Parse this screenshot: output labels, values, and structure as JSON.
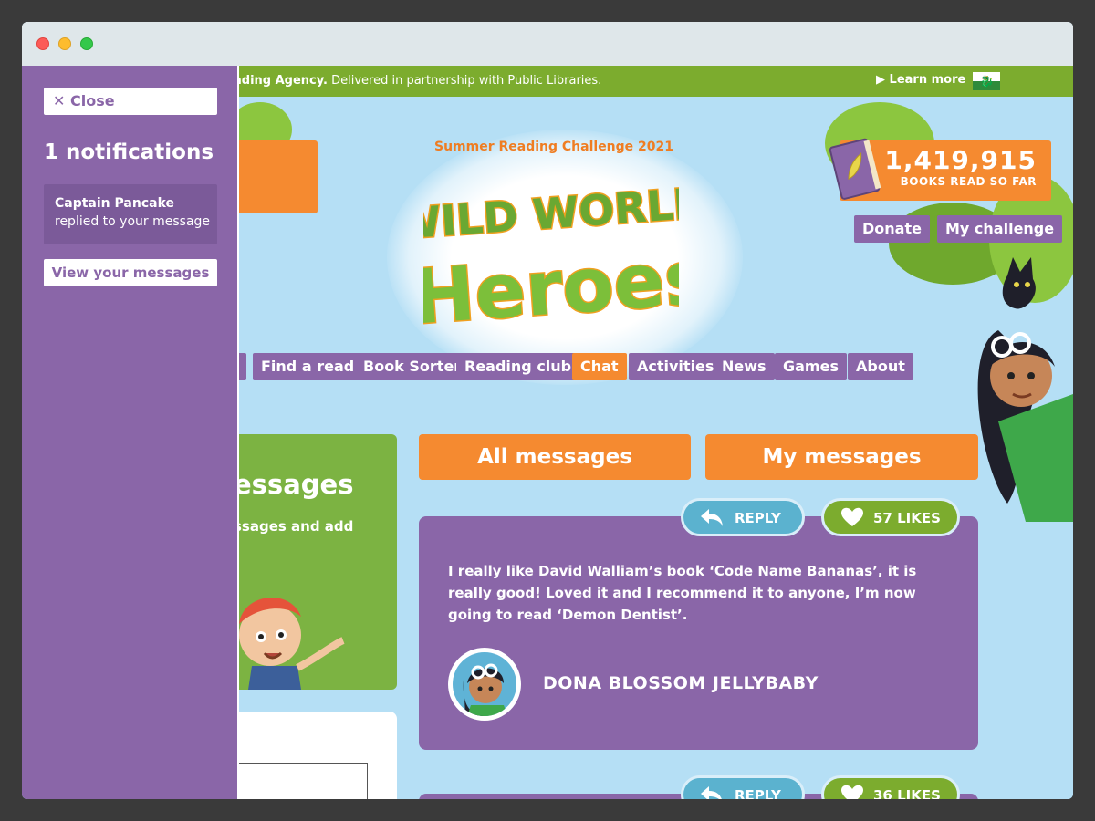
{
  "banner": {
    "agency_bold": "ading Agency.",
    "agency_text": " Delivered in partnership with Public Libraries.",
    "learn_more": "Learn more",
    "flag_icon": "welsh-flag-icon"
  },
  "header": {
    "tagline": "Summer Reading Challenge 2021",
    "logo_line1": "WILD WORLD",
    "logo_line2": "Heroes",
    "counter_value": "1,419,915",
    "counter_label": "BOOKS READ SO FAR",
    "donate": "Donate",
    "my_challenge": "My challenge"
  },
  "nav": {
    "items": [
      "Find a read",
      "Book Sorter",
      "Reading club",
      "Chat",
      "Activities",
      "News",
      "Games",
      "About"
    ],
    "active": "Chat"
  },
  "left_card": {
    "title": "essages",
    "text": "ssages and add"
  },
  "tabs": {
    "all": "All messages",
    "mine": "My messages"
  },
  "messages": [
    {
      "reply_label": "REPLY",
      "likes_label": "57 LIKES",
      "text": "I really like David Walliam’s book ‘Code Name Bananas’, it is really good! Loved it and I recommend it to anyone, I’m now going to read ‘Demon Dentist’.",
      "author": "DONA BLOSSOM JELLYBABY"
    },
    {
      "reply_label": "REPLY",
      "likes_label": "36 LIKES"
    }
  ],
  "drawer": {
    "close": "✕ Close",
    "title": "1 notifications",
    "notification": {
      "who": "Captain Pancake",
      "what": "replied to your message"
    },
    "view_messages": "View your messages"
  },
  "colors": {
    "purple": "#8a66a8",
    "orange": "#f58a30",
    "green": "#7cac2e",
    "sky": "#b5dff5",
    "reply_blue": "#5bb2cf"
  }
}
